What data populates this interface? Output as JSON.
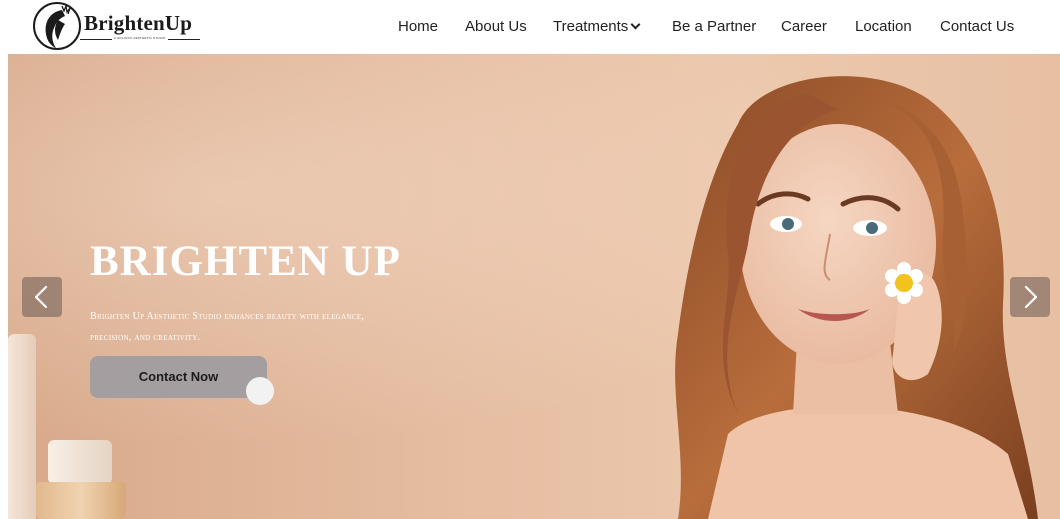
{
  "brand": {
    "name": "BrightenUp",
    "tagline": "A HOLISTIC AESTHETIC STUDIO",
    "logo_icon": "woman-silhouette-logo"
  },
  "nav": {
    "items": [
      {
        "label": "Home"
      },
      {
        "label": "About Us"
      },
      {
        "label": "Treatments",
        "icon": "chevron-down-icon"
      },
      {
        "label": "Be a Partner"
      },
      {
        "label": "Career"
      },
      {
        "label": "Location"
      },
      {
        "label": "Contact Us"
      }
    ]
  },
  "hero": {
    "title": "BRIGHTEN UP",
    "subtitle": "Brighten Up Aesthetic Studio enhances beauty with elegance, precision, and creativity.",
    "cta_label": "Contact Now",
    "prev_icon": "chevron-left-icon",
    "next_icon": "chevron-right-icon"
  },
  "colors": {
    "hero_bg": "#e6bea2",
    "cta_bg": "#a49ea1",
    "text_dark": "#222222",
    "text_light": "#ffffff"
  }
}
